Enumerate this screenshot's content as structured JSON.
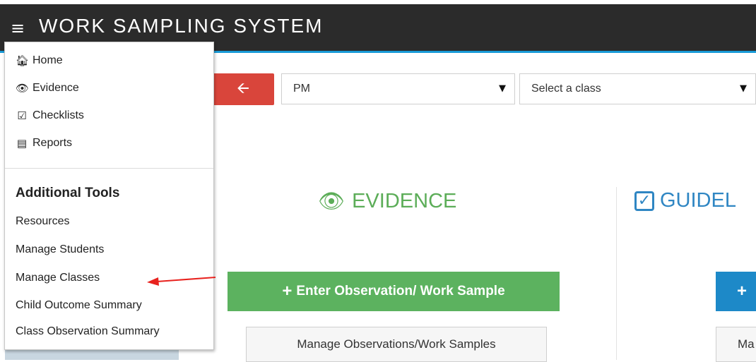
{
  "header": {
    "app_title": "WORK SAMPLING SYSTEM",
    "menu_toggle_icon": "hamburger-icon",
    "background_color": "#2b2b2b",
    "accent_color": "#1a9bd7"
  },
  "nav_menu": {
    "items": [
      {
        "label": "Home",
        "icon": "home-icon"
      },
      {
        "label": "Evidence",
        "icon": "eye-icon"
      },
      {
        "label": "Checklists",
        "icon": "checkbox-icon"
      },
      {
        "label": "Reports",
        "icon": "list-icon"
      }
    ],
    "tools_heading": "Additional Tools",
    "tools": [
      {
        "label": "Resources"
      },
      {
        "label": "Manage Students"
      },
      {
        "label": "Manage Classes"
      },
      {
        "label": "Child Outcome Summary"
      },
      {
        "label": "Class Observation Summary"
      }
    ]
  },
  "toolbar": {
    "back_icon": "arrow-left-icon",
    "back_color": "#d9453b",
    "session_select": {
      "value": "PM"
    },
    "class_select": {
      "value": "Select a class"
    }
  },
  "evidence_section": {
    "heading": "EVIDENCE",
    "icon": "eye-icon",
    "color": "#5cad58",
    "primary_button": "Enter Observation/ Work Sample",
    "secondary_button": "Manage Observations/Work Samples"
  },
  "guidelines_section": {
    "heading": "GUIDEL",
    "icon": "checkbox-icon",
    "color": "#2f86c3",
    "secondary_button": "Ma"
  },
  "annotation": {
    "color": "#e8221e"
  }
}
